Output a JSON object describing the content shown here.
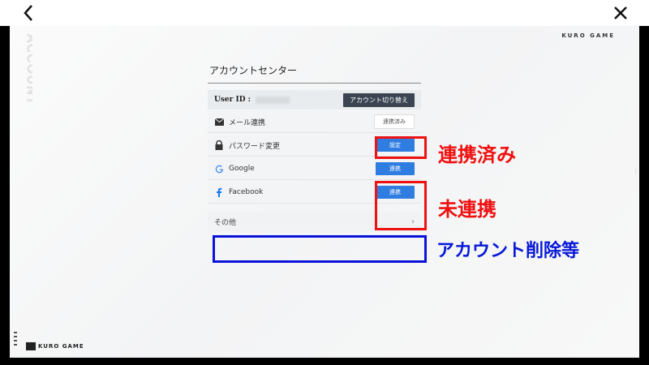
{
  "window": {
    "back_icon": "chevron-left-icon",
    "close_icon": "close-icon"
  },
  "branding": {
    "vertical_label": "ACCOUNT",
    "top_brand": "KURO GAME",
    "bottom_brand": "KURO GAME"
  },
  "account_center": {
    "title": "アカウントセンター",
    "user_label": "User ID :",
    "switch_button": "アカウント切り替え",
    "rows": [
      {
        "icon": "mail-icon",
        "label": "メール連携",
        "button": "連携済み",
        "state": "done"
      },
      {
        "icon": "lock-icon",
        "label": "パスワード変更",
        "button": "設定",
        "state": "action"
      },
      {
        "icon": "google-icon",
        "label": "Google",
        "button": "連携",
        "state": "action"
      },
      {
        "icon": "facebook-icon",
        "label": "Facebook",
        "button": "連携",
        "state": "action"
      }
    ],
    "other_label": "その他",
    "other_icon": "chevron-right-icon"
  },
  "annotations": {
    "linked": "連携済み",
    "unlinked": "未連携",
    "delete_etc": "アカウント削除等",
    "colors": {
      "red": "#f01010",
      "blue": "#0718d8"
    }
  }
}
